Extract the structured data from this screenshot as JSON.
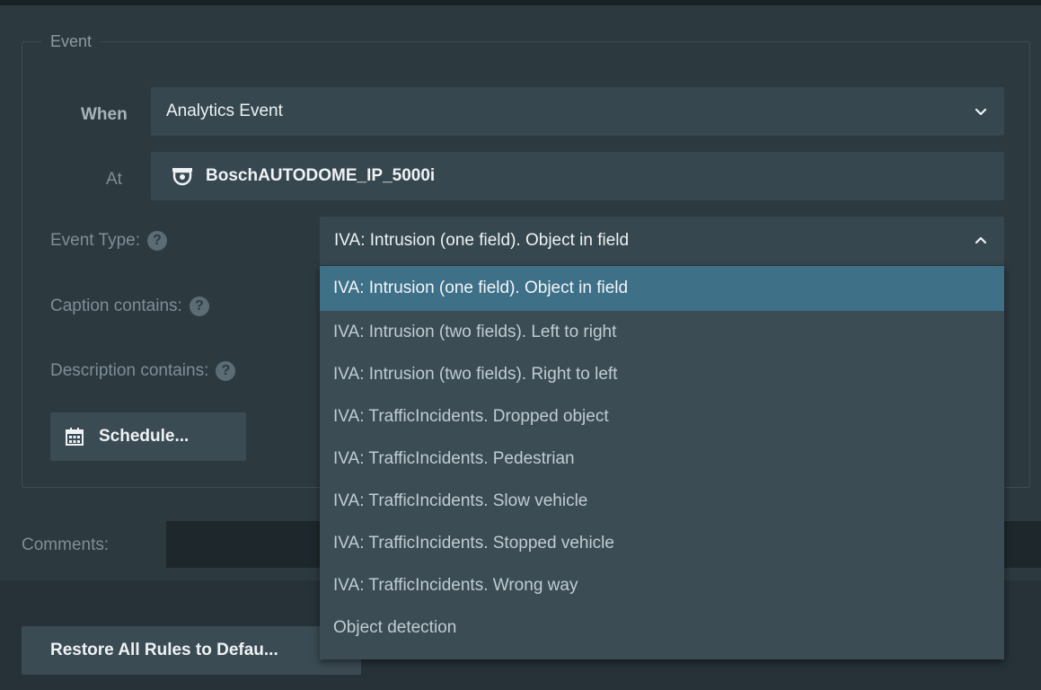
{
  "fieldset": {
    "legend": "Event"
  },
  "when": {
    "label": "When",
    "value": "Analytics Event"
  },
  "at": {
    "label": "At",
    "value": "BoschAUTODOME_IP_5000i",
    "icon": "camera-dome-icon"
  },
  "event_type": {
    "label": "Event Type:",
    "value": "IVA: Intrusion (one field). Object in field",
    "help": "?",
    "options": [
      "IVA: Intrusion (one field). Object in field",
      "IVA: Intrusion (two fields). Left to right",
      "IVA: Intrusion (two fields). Right to left",
      "IVA: TrafficIncidents. Dropped object",
      "IVA: TrafficIncidents. Pedestrian",
      "IVA: TrafficIncidents. Slow vehicle",
      "IVA: TrafficIncidents. Stopped vehicle",
      "IVA: TrafficIncidents. Wrong way",
      "Object detection"
    ],
    "selected_index": 0
  },
  "caption": {
    "label": "Caption contains:",
    "help": "?"
  },
  "description": {
    "label": "Description contains:",
    "help": "?"
  },
  "schedule_button": {
    "label": "Schedule...",
    "icon": "calendar-icon"
  },
  "comments": {
    "label": "Comments:"
  },
  "restore_button": {
    "label": "Restore All Rules to Defau..."
  },
  "colors": {
    "accent": "#3e7088",
    "panel": "#2c393f",
    "field": "#37474f"
  }
}
